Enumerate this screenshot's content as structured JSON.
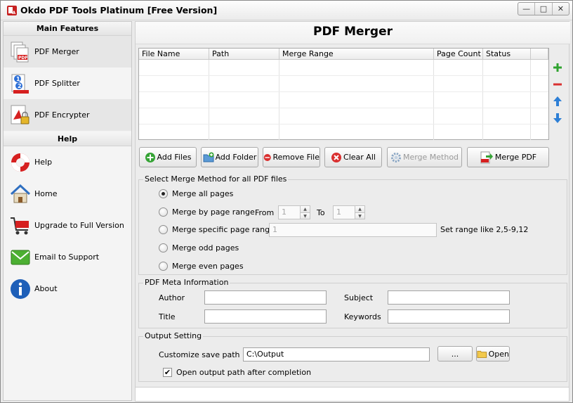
{
  "window": {
    "title": "Okdo PDF Tools Platinum [Free Version]",
    "minimize": "—",
    "maximize": "□",
    "close": "✕"
  },
  "sidebar": {
    "main_features_title": "Main Features",
    "features": [
      {
        "label": "PDF Merger",
        "icon": "pdf-merger-icon"
      },
      {
        "label": "PDF Splitter",
        "icon": "pdf-splitter-icon"
      },
      {
        "label": "PDF Encrypter",
        "icon": "pdf-encrypter-icon"
      }
    ],
    "help_title": "Help",
    "help_items": [
      {
        "label": "Help",
        "icon": "lifebuoy-icon"
      },
      {
        "label": "Home",
        "icon": "home-icon"
      },
      {
        "label": "Upgrade to Full Version",
        "icon": "cart-icon"
      },
      {
        "label": "Email to Support",
        "icon": "envelope-icon"
      },
      {
        "label": "About",
        "icon": "info-icon"
      }
    ]
  },
  "main": {
    "title": "PDF Merger",
    "table": {
      "columns": [
        "File Name",
        "Path",
        "Merge Range",
        "Page Count",
        "Status",
        ""
      ],
      "rows": []
    },
    "buttons": {
      "add_files": "Add Files",
      "add_folder": "Add Folder",
      "remove_file": "Remove File",
      "clear_all": "Clear All",
      "merge_method": "Merge Method",
      "merge_pdf": "Merge PDF"
    },
    "merge_method": {
      "legend": "Select Merge Method for all PDF files",
      "options": [
        "Merge all pages",
        "Merge by page range",
        "Merge specific page range",
        "Merge odd pages",
        "Merge even pages"
      ],
      "selected": "Merge all pages",
      "from_label": "From",
      "from_value": "1",
      "to_label": "To",
      "to_value": "1",
      "specific_value": "1",
      "specific_hint": "Set range like 2,5-9,12"
    },
    "meta": {
      "legend": "PDF Meta Information",
      "author_label": "Author",
      "author_value": "",
      "subject_label": "Subject",
      "subject_value": "",
      "title_label": "Title",
      "title_value": "",
      "keywords_label": "Keywords",
      "keywords_value": ""
    },
    "output": {
      "legend": "Output Setting",
      "save_path_label": "Customize save path",
      "save_path_value": "C:\\Output",
      "browse_label": "...",
      "open_label": "Open",
      "open_after_label": "Open output path after completion",
      "open_after_checked": true
    }
  },
  "colors": {
    "accent_red": "#d62020",
    "plus_green": "#2fa32f",
    "minus_red": "#d93030",
    "arrow_blue": "#2d7fd6"
  }
}
